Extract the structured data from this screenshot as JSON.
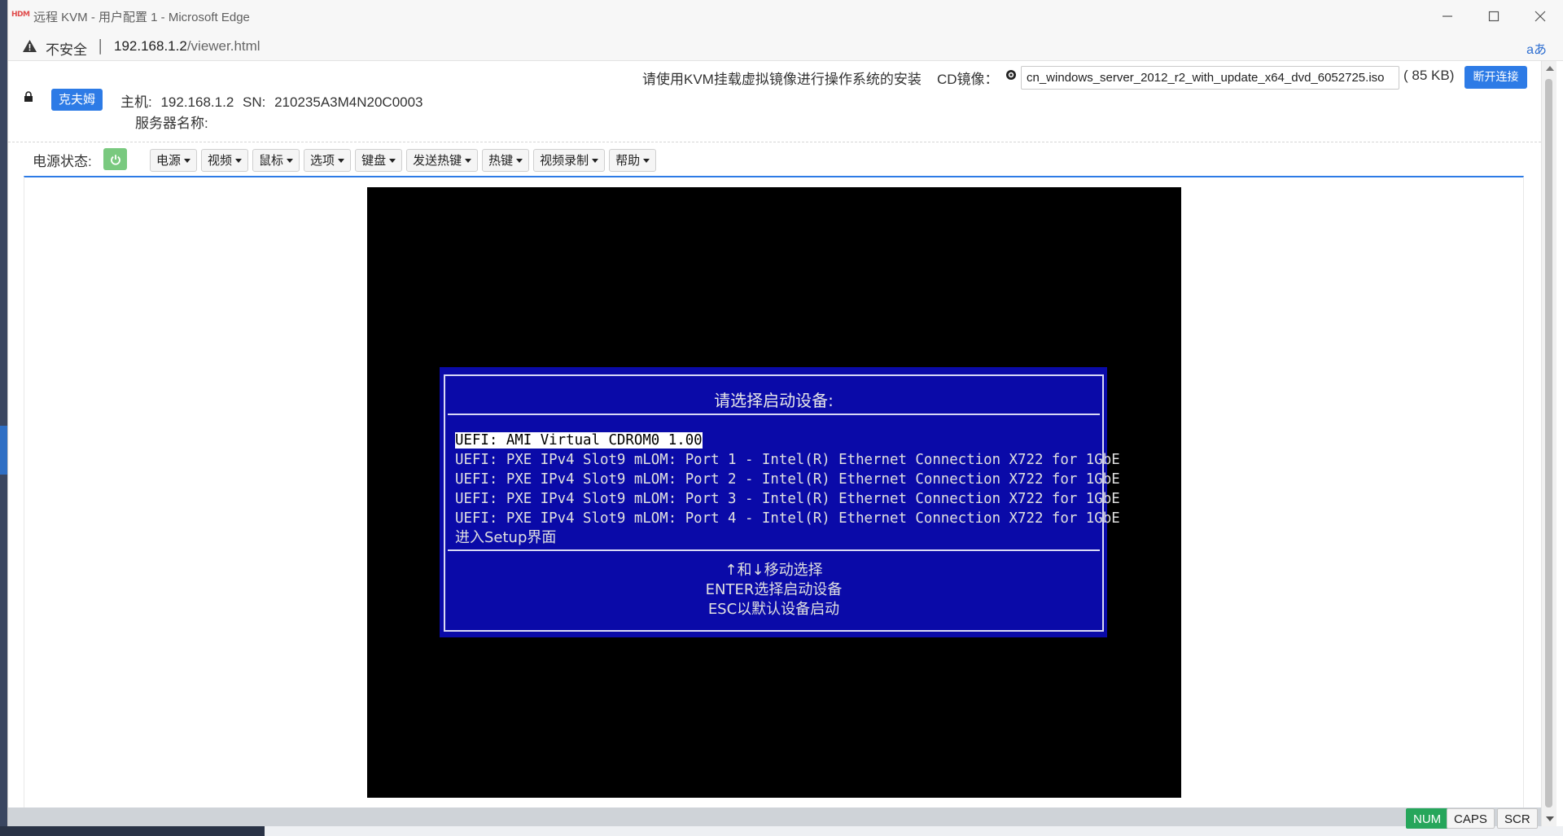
{
  "browser": {
    "favicon_text": "HDM",
    "title": "远程 KVM - 用户配置 1 - Microsoft Edge",
    "not_secure": "不安全",
    "separator": "|",
    "url_host": "192.168.1.2",
    "url_path": "/viewer.html",
    "read_aloud": "aあ"
  },
  "header": {
    "user_badge": "克夫姆",
    "host_label": "主机:",
    "host_value": "192.168.1.2",
    "sn_label": "SN:",
    "sn_value": "210235A3M4N20C0003",
    "server_name_label": "服务器名称:",
    "iso_hint": "请使用KVM挂载虚拟镜像进行操作系统的安装",
    "cd_label": "CD镜像：",
    "iso_filename": "cn_windows_server_2012_r2_with_update_x64_dvd_6052725.iso",
    "iso_size": "( 85 KB)",
    "disconnect_button": "断开连接"
  },
  "toolbar": {
    "power_status_label": "电源状态:",
    "power_status_color": "#79c97f",
    "menus": [
      "电源",
      "视频",
      "鼠标",
      "选项",
      "键盘",
      "发送热键",
      "热键",
      "视频录制",
      "帮助"
    ]
  },
  "remote_screen": {
    "title": "请选择启动设备:",
    "boot_items": [
      "UEFI: AMI Virtual CDROM0 1.00",
      "UEFI: PXE IPv4 Slot9 mLOM: Port 1 - Intel(R) Ethernet Connection X722 for 1GbE",
      "UEFI: PXE IPv4 Slot9 mLOM: Port 2 - Intel(R) Ethernet Connection X722 for 1GbE",
      "UEFI: PXE IPv4 Slot9 mLOM: Port 3 - Intel(R) Ethernet Connection X722 for 1GbE",
      "UEFI: PXE IPv4 Slot9 mLOM: Port 4 - Intel(R) Ethernet Connection X722 for 1GbE"
    ],
    "setup_item": "进入Setup界面",
    "help_lines": [
      "↑和↓移动选择",
      "ENTER选择启动设备",
      "ESC以默认设备启动"
    ],
    "background_color": "#0a0aa8"
  },
  "status_keys": {
    "num": "NUM",
    "caps": "CAPS",
    "scr": "SCR",
    "active_color": "#26a65b"
  }
}
